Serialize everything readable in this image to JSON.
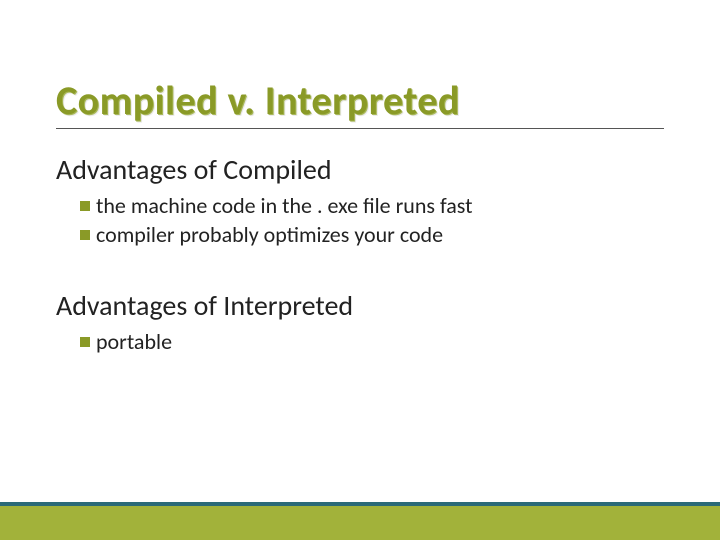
{
  "title": "Compiled v. Interpreted",
  "section1": {
    "heading": "Advantages of Compiled",
    "items": [
      "the machine code in the . exe file runs fast",
      "compiler probably optimizes your code"
    ]
  },
  "section2": {
    "heading": "Advantages of Interpreted",
    "items": [
      "portable"
    ]
  }
}
